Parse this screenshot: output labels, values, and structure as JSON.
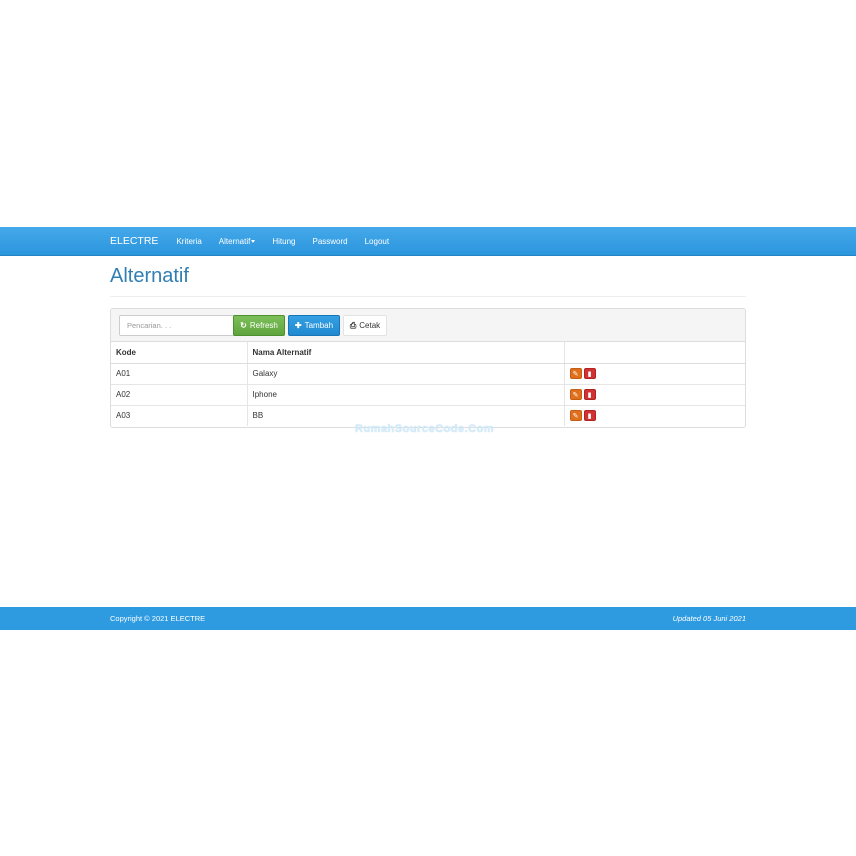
{
  "navbar": {
    "brand": "ELECTRE",
    "items": [
      {
        "label": "Kriteria"
      },
      {
        "label": "Alternatif"
      },
      {
        "label": "Hitung"
      },
      {
        "label": "Password"
      },
      {
        "label": "Logout"
      }
    ]
  },
  "page": {
    "title": "Alternatif"
  },
  "toolbar": {
    "search_placeholder": "Pencarian. . .",
    "refresh_label": "Refresh",
    "add_label": "Tambah",
    "print_label": "Cetak"
  },
  "table": {
    "headers": [
      "Kode",
      "Nama Alternatif",
      ""
    ],
    "rows": [
      {
        "kode": "A01",
        "nama": "Galaxy"
      },
      {
        "kode": "A02",
        "nama": "Iphone"
      },
      {
        "kode": "A03",
        "nama": "BB"
      }
    ]
  },
  "watermark": "RumahSourceCode.Com",
  "footer": {
    "copyright": "Copyright © 2021 ELECTRE",
    "updated": "Updated 05 Juni 2021"
  },
  "colors": {
    "navbar": "#2b95dd",
    "title": "#2f7fb3",
    "refresh": "#5ea43c",
    "add": "#1f88cf",
    "edit": "#e0701e",
    "delete": "#d03131",
    "footer": "#2e9be0"
  },
  "icons": {
    "refresh": "refresh-icon",
    "add": "plus-icon",
    "print": "print-icon",
    "edit": "edit-icon",
    "delete": "trash-icon"
  }
}
